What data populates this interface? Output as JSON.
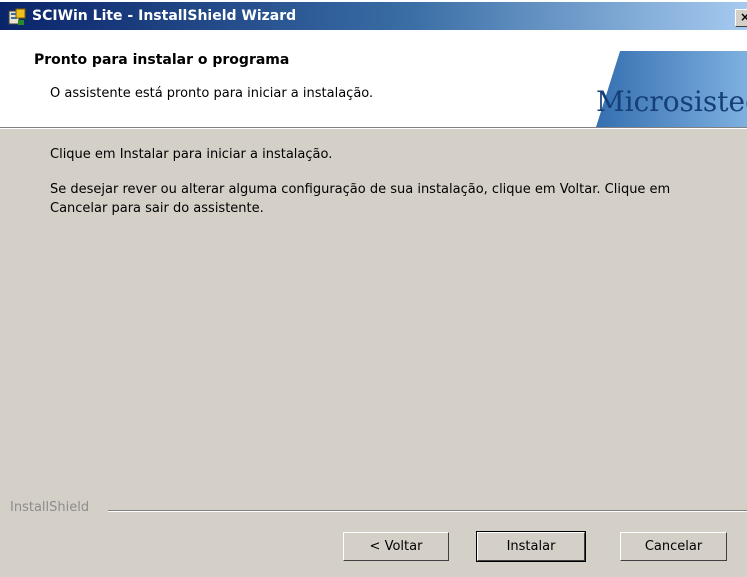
{
  "window": {
    "title": "SCIWin Lite - InstallShield Wizard",
    "close_glyph": "×"
  },
  "header": {
    "title": "Pronto para instalar o programa",
    "subtitle": "O assistente está pronto para iniciar a instalação.",
    "logo_text": "Microsisted"
  },
  "body": {
    "line1": "Clique em Instalar para iniciar a instalação.",
    "line2": "Se desejar rever ou alterar alguma configuração de sua instalação, clique em Voltar. Clique em Cancelar para sair do assistente."
  },
  "footer": {
    "brand": "InstallShield"
  },
  "buttons": {
    "back": "< Voltar",
    "install": "Instalar",
    "cancel": "Cancelar"
  },
  "colors": {
    "title_bar_start": "#0a246a",
    "title_bar_end": "#a6caf0",
    "dialog_bg": "#d4d0c8",
    "logo_blue": "#1f5fa8"
  }
}
